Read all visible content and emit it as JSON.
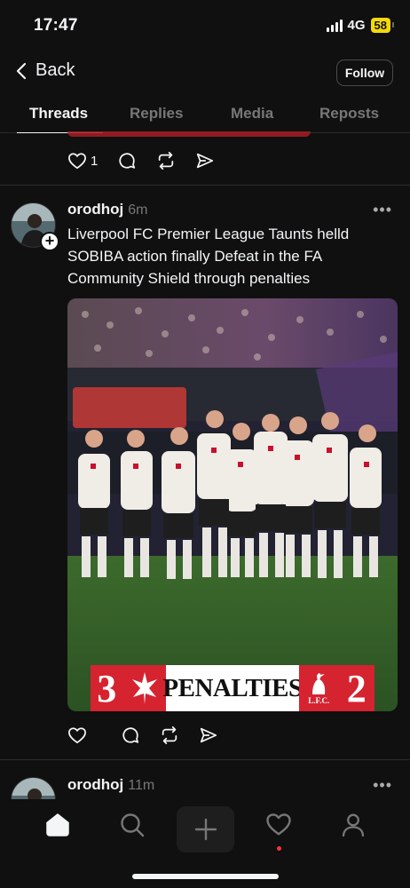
{
  "status_bar": {
    "time": "17:47",
    "network": "4G",
    "battery": "58"
  },
  "nav": {
    "back_label": "Back",
    "follow_label": "Follow"
  },
  "tabs": [
    {
      "label": "Threads"
    },
    {
      "label": "Replies"
    },
    {
      "label": "Media"
    },
    {
      "label": "Reposts"
    }
  ],
  "prev_post": {
    "like_count": "1"
  },
  "post": {
    "username": "orodhoj",
    "time_ago": "6m",
    "more_label": "•••",
    "text": "Liverpool FC Premier League Taunts helld SOBIBA action finally Defeat in the FA Community Shield through penalties",
    "media": {
      "score_left": "3",
      "banner_label": "PENALTIES",
      "score_right": "2",
      "left_crest_text": "",
      "right_crest_text": "L.F.C."
    }
  },
  "next_post": {
    "username": "orodhoj",
    "time_ago": "11m",
    "more_label": "•••"
  },
  "bottom_nav": [
    "home-icon",
    "search-icon",
    "compose-icon",
    "heart-icon",
    "profile-icon"
  ],
  "colors": {
    "background": "#101010",
    "accent_red": "#d52330",
    "notification": "#ff3040"
  }
}
